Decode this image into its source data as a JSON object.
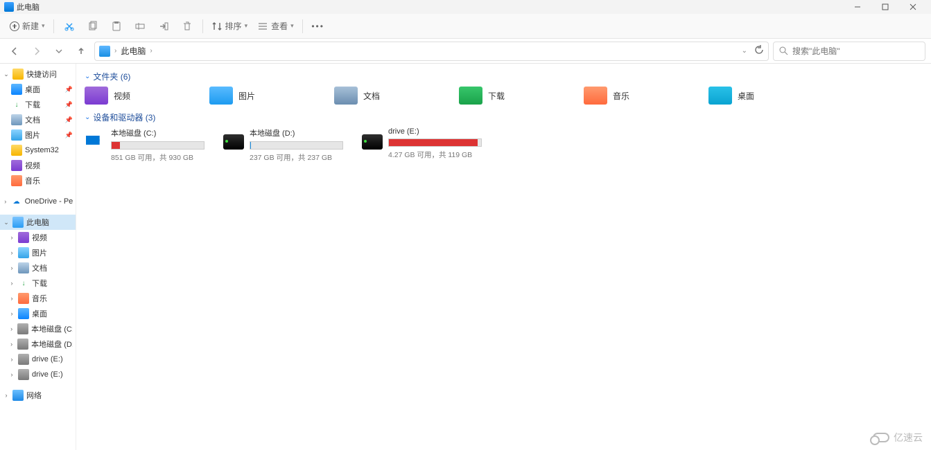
{
  "title": "此电脑",
  "toolbar": {
    "new": "新建",
    "sort": "排序",
    "view": "查看"
  },
  "breadcrumb": {
    "root": "此电脑"
  },
  "search_placeholder": "搜索\"此电脑\"",
  "sidebar": {
    "quick": {
      "label": "快捷访问",
      "expanded": true
    },
    "quick_items": [
      {
        "label": "桌面",
        "icon": "ic-desk",
        "pin": true
      },
      {
        "label": "下载",
        "icon": "ic-dl",
        "pin": true,
        "glyph": "↓"
      },
      {
        "label": "文档",
        "icon": "ic-doc",
        "pin": true
      },
      {
        "label": "图片",
        "icon": "ic-pic",
        "pin": true
      },
      {
        "label": "System32",
        "icon": "ic-sys"
      },
      {
        "label": "视频",
        "icon": "ic-vid"
      },
      {
        "label": "音乐",
        "icon": "ic-mus"
      }
    ],
    "onedrive": {
      "label": "OneDrive - Person"
    },
    "thispc": {
      "label": "此电脑",
      "active": true
    },
    "thispc_items": [
      {
        "label": "视频",
        "icon": "ic-vid"
      },
      {
        "label": "图片",
        "icon": "ic-pic"
      },
      {
        "label": "文档",
        "icon": "ic-doc"
      },
      {
        "label": "下载",
        "icon": "ic-dl",
        "glyph": "↓"
      },
      {
        "label": "音乐",
        "icon": "ic-mus"
      },
      {
        "label": "桌面",
        "icon": "ic-desk"
      },
      {
        "label": "本地磁盘 (C:)",
        "icon": "ic-drive"
      },
      {
        "label": "本地磁盘 (D:)",
        "icon": "ic-drive"
      },
      {
        "label": "drive (E:)",
        "icon": "ic-drive"
      },
      {
        "label": "drive (E:)",
        "icon": "ic-drive"
      }
    ],
    "network": {
      "label": "网络"
    }
  },
  "groups": {
    "folders": {
      "title": "文件夹 (6)"
    },
    "drives": {
      "title": "设备和驱动器 (3)"
    }
  },
  "folders": [
    {
      "label": "视频",
      "icon": "f-vid"
    },
    {
      "label": "图片",
      "icon": "f-pic"
    },
    {
      "label": "文档",
      "icon": "f-doc"
    },
    {
      "label": "下载",
      "icon": "f-dl"
    },
    {
      "label": "音乐",
      "icon": "f-mus"
    },
    {
      "label": "桌面",
      "icon": "f-dsk"
    }
  ],
  "drives": [
    {
      "name": "本地磁盘 (C:)",
      "free": "851 GB 可用，共 930 GB",
      "fill": 9,
      "color": "red",
      "win": true
    },
    {
      "name": "本地磁盘 (D:)",
      "free": "237 GB 可用，共 237 GB",
      "fill": 1,
      "color": "blue"
    },
    {
      "name": "drive (E:)",
      "free": "4.27 GB 可用，共 119 GB",
      "fill": 96,
      "color": "red"
    }
  ],
  "watermark": "亿速云"
}
